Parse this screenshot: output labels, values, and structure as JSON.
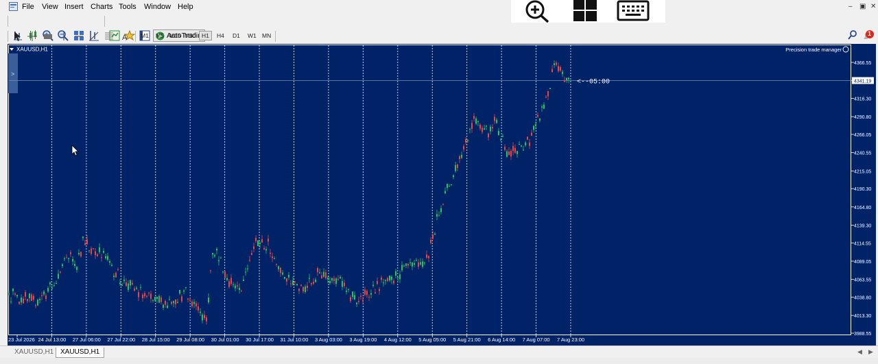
{
  "menu": [
    "File",
    "View",
    "Insert",
    "Charts",
    "Tools",
    "Window",
    "Help"
  ],
  "toolbar": {
    "autotrading_label": "AutoTrading"
  },
  "timeframes": [
    "M1",
    "M5",
    "M15",
    "M30",
    "H1",
    "H4",
    "D1",
    "W1",
    "MN"
  ],
  "active_timeframe": "H1",
  "chart": {
    "symbol_label": "XAUUSD,H1",
    "indicator_label": "Precision  trade manager",
    "countdown_label": "<--05:00",
    "current_price": "4341.19",
    "price_ticks": [
      "4366.55",
      "4341.19",
      "4316.30",
      "4290.80",
      "4266.05",
      "4240.55",
      "4215.05",
      "4190.30",
      "4164.80",
      "4139.30",
      "4114.55",
      "4089.05",
      "4063.55",
      "4038.80",
      "4013.30",
      "3988.55"
    ],
    "time_ticks": [
      "23 Jul 2026",
      "24 Jul 13:00",
      "27 Jul 06:00",
      "27 Jul 22:00",
      "28 Jul 15:00",
      "29 Jul 08:00",
      "30 Jul 01:00",
      "30 Jul 17:00",
      "31 Jul 10:00",
      "3 Aug 03:00",
      "3 Aug 19:00",
      "4 Aug 12:00",
      "5 Aug 05:00",
      "5 Aug 21:00",
      "6 Aug 14:00",
      "7 Aug 07:00",
      "7 Aug 23:00"
    ],
    "colors": {
      "background": "#002266",
      "bull": "#22c55e",
      "bear": "#ef4444",
      "grid": "#e6e6e6",
      "axis": "#ffffff"
    }
  },
  "tabs": [
    "XAUUSD,H1",
    "XAUUSD,H1"
  ],
  "active_tab": 1,
  "notification_count": "1"
}
